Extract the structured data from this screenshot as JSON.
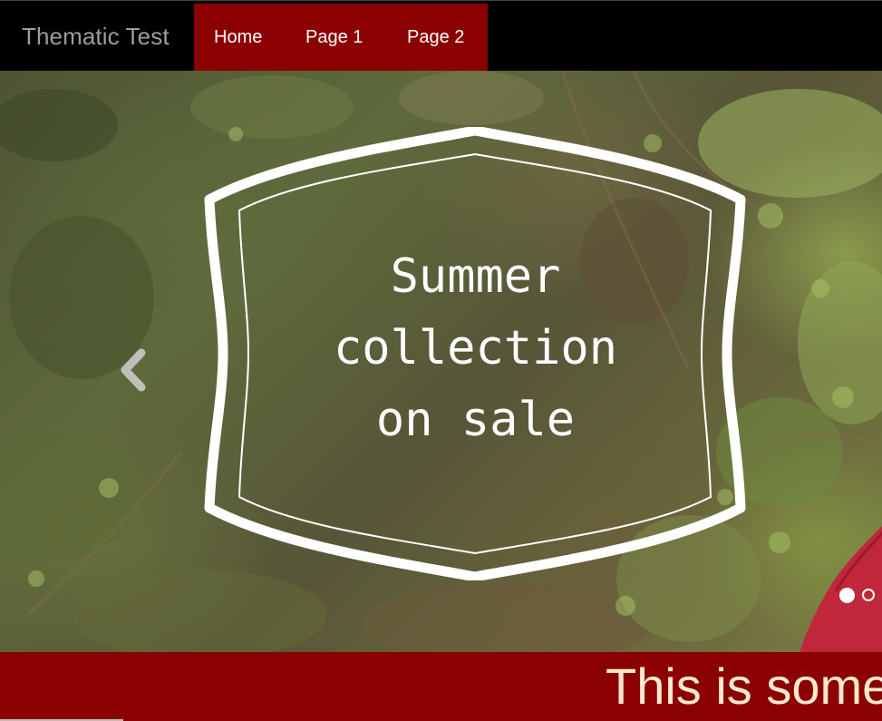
{
  "navbar": {
    "brand": "Thematic Test",
    "links": [
      {
        "label": "Home"
      },
      {
        "label": "Page 1"
      },
      {
        "label": "Page 2"
      }
    ],
    "colors": {
      "background": "#000000",
      "active_group": "#8b0000",
      "brand_text": "#9d9d9d"
    }
  },
  "carousel": {
    "slide_lines": [
      "Summer",
      "collection",
      "on sale"
    ],
    "prev_icon": "chevron-left-icon",
    "indicators": [
      {
        "active": true
      },
      {
        "active": false
      }
    ]
  },
  "banner": {
    "text": "This is some",
    "colors": {
      "background": "#8b0000",
      "text": "#fde9cf"
    }
  }
}
